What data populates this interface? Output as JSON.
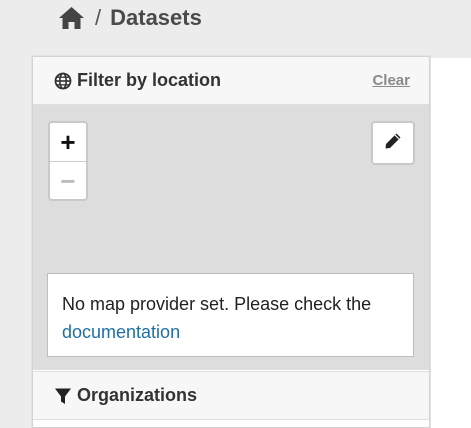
{
  "breadcrumb": {
    "home_icon": "home-icon",
    "separator": "/",
    "current": "Datasets"
  },
  "location_filter": {
    "icon": "globe-icon",
    "title": "Filter by location",
    "clear_label": "Clear",
    "map": {
      "zoom_in_label": "+",
      "zoom_out_label": "−",
      "draw_icon": "pencil-icon",
      "notice_text": "No map provider set. Please check the",
      "notice_link": "documentation"
    }
  },
  "organizations": {
    "icon": "filter-icon",
    "title": "Organizations"
  }
}
